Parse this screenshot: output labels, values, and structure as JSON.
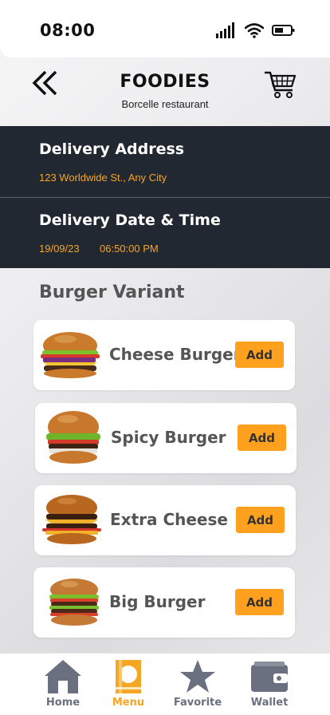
{
  "status_bar": {
    "time": "08:00",
    "icons": [
      "signal-icon",
      "wifi-icon",
      "battery-icon"
    ]
  },
  "header": {
    "title": "FOODIES",
    "subtitle": "Borcelle restaurant",
    "back_icon": "double-chevron-left-icon",
    "cart_icon": "cart-icon"
  },
  "delivery": {
    "address_label": "Delivery Address",
    "address_value": "123 Worldwide St., Any City",
    "datetime_label": "Delivery Date & Time",
    "date_value": "19/09/23",
    "time_value": "06:50:00 PM"
  },
  "section": {
    "title": "Burger Variant"
  },
  "items": [
    {
      "name": "Cheese Burger",
      "add_label": "Add"
    },
    {
      "name": "Spicy Burger",
      "add_label": "Add"
    },
    {
      "name": "Extra Cheese",
      "add_label": "Add"
    },
    {
      "name": "Big Burger",
      "add_label": "Add"
    }
  ],
  "tabs": [
    {
      "label": "Home",
      "icon": "home-icon",
      "active": false
    },
    {
      "label": "Menu",
      "icon": "menu-icon",
      "active": true
    },
    {
      "label": "Favorite",
      "icon": "star-icon",
      "active": false
    },
    {
      "label": "Wallet",
      "icon": "wallet-icon",
      "active": false
    }
  ],
  "colors": {
    "accent": "#f5a623",
    "add_button": "#ffa01f",
    "dark_panel": "#222831",
    "tab_inactive": "#6b7080"
  }
}
